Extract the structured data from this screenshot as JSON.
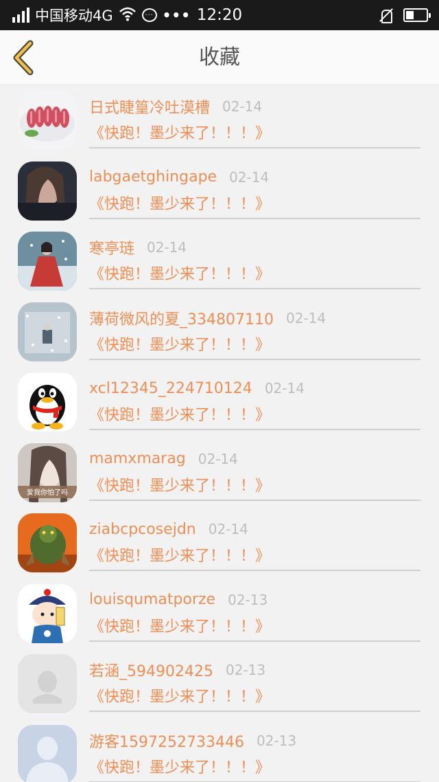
{
  "status_bar": {
    "carrier": "中国移动4G",
    "time": "12:20",
    "battery_level": 0.4,
    "signal_bars": 4
  },
  "header": {
    "title": "收藏",
    "back_icon": "chevron-left-icon"
  },
  "colors": {
    "accent": "#ee8e55",
    "date_gray": "#bdbdbd",
    "background": "#f2f2f2"
  },
  "favorites": [
    {
      "name": "日式睫篁冷吐漠槽",
      "date": "02-14",
      "title": "《快跑！墨少来了！！！》",
      "avatar": "food-sashimi"
    },
    {
      "name": "labgaetghingape",
      "date": "02-14",
      "title": "《快跑！墨少来了！！！》",
      "avatar": "girl-dark"
    },
    {
      "name": "寒亭琏",
      "date": "02-14",
      "title": "《快跑！墨少来了！！！》",
      "avatar": "red-dress-snow"
    },
    {
      "name": "薄荷微风的夏_334807110",
      "date": "02-14",
      "title": "《快跑！墨少来了！！！》",
      "avatar": "snow-scene"
    },
    {
      "name": "xcl12345_224710124",
      "date": "02-14",
      "title": "《快跑！墨少来了！！！》",
      "avatar": "qq-penguin"
    },
    {
      "name": "mamxmarag",
      "date": "02-14",
      "title": "《快跑！墨少来了！！！》",
      "avatar": "girl-caption"
    },
    {
      "name": "ziabcpcosejdn",
      "date": "02-14",
      "title": "《快跑！墨少来了！！！》",
      "avatar": "green-monster"
    },
    {
      "name": "louisqumatporze",
      "date": "02-13",
      "title": "《快跑！墨少来了！！！》",
      "avatar": "cartoon-qing-official"
    },
    {
      "name": "若涵_594902425",
      "date": "02-13",
      "title": "《快跑！墨少来了！！！》",
      "avatar": "default-penguin"
    },
    {
      "name": "游客1597252733446",
      "date": "02-13",
      "title": "《快跑！墨少来了！！！》",
      "avatar": "default-person"
    }
  ]
}
